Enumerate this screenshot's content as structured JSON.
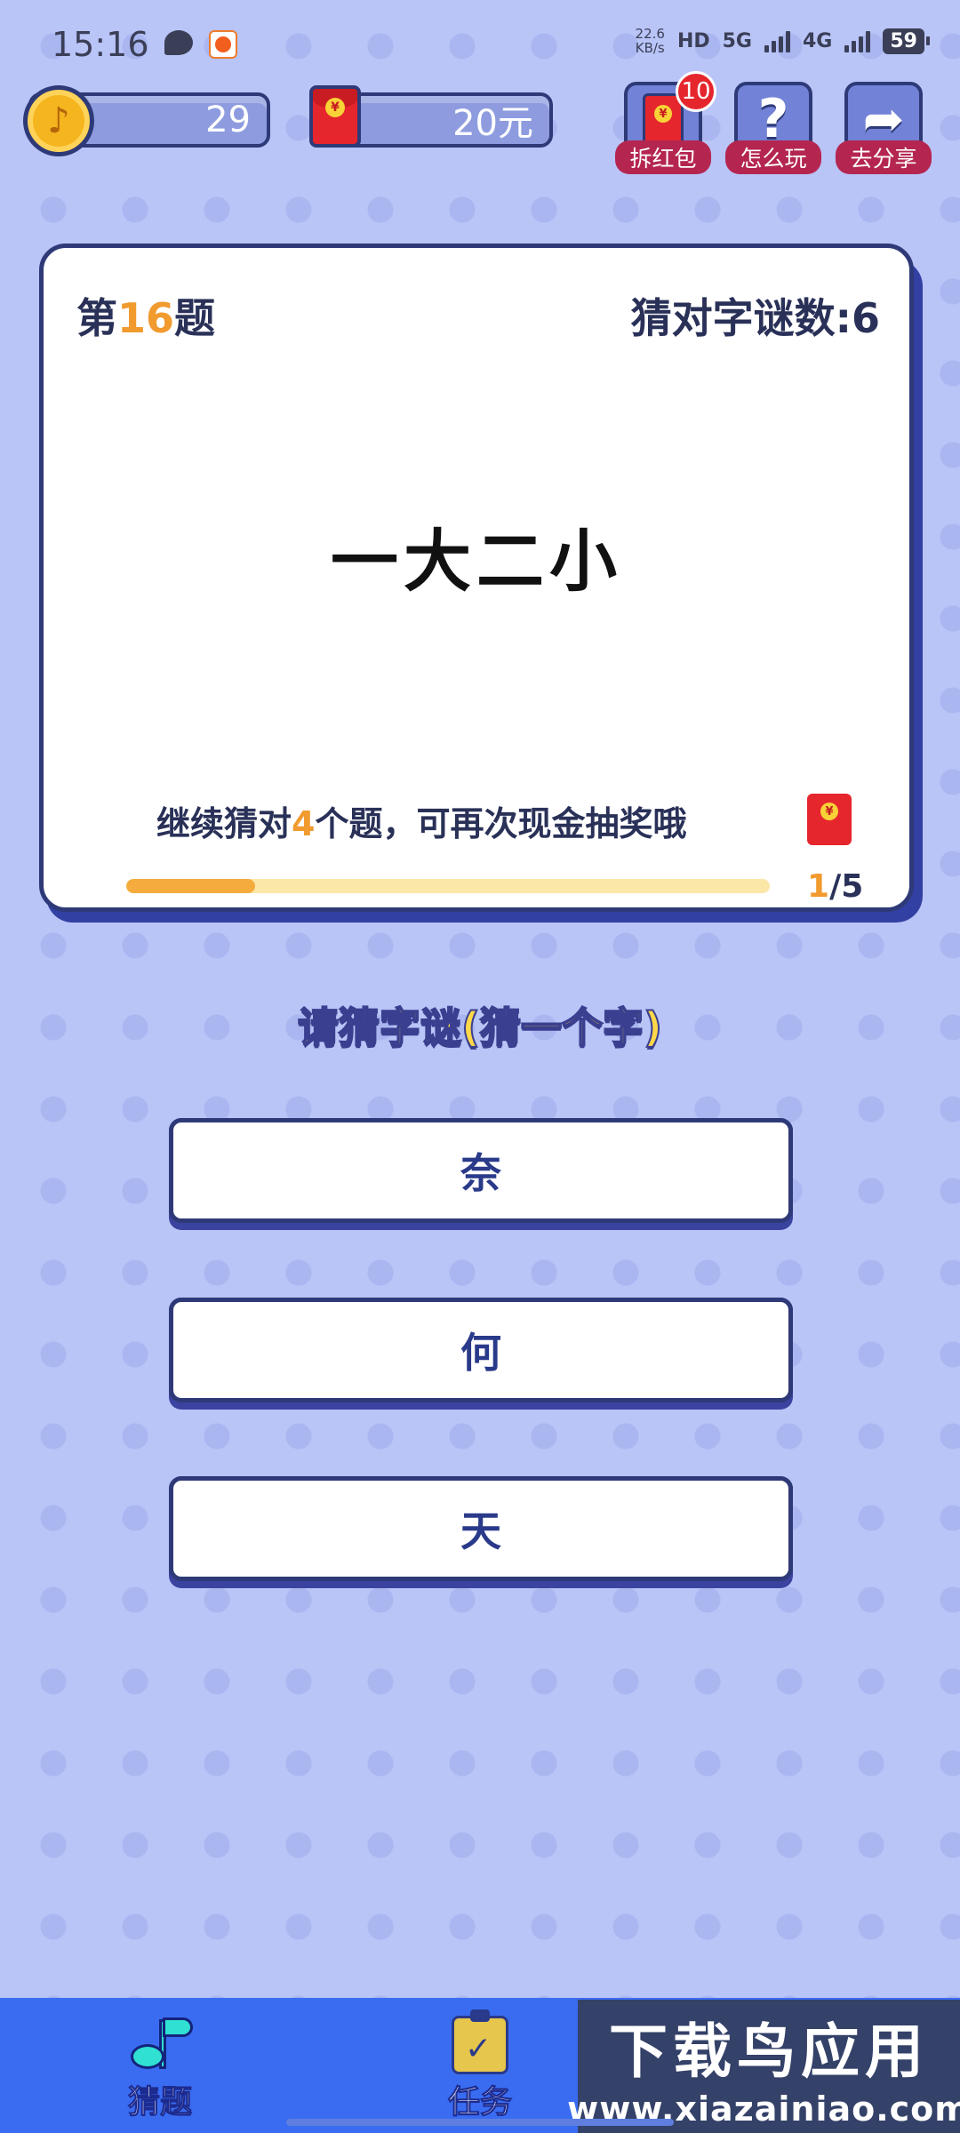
{
  "status_bar": {
    "time": "15:16",
    "speed_value": "22.6",
    "speed_unit": "KB/s",
    "hd_label": "HD",
    "net_5g": "5G",
    "net_4g": "4G",
    "battery": "59"
  },
  "wallet": {
    "coins": "29",
    "cash": "20元"
  },
  "top_buttons": {
    "hongbao_label": "拆红包",
    "hongbao_badge": "10",
    "howto_label": "怎么玩",
    "share_label": "去分享"
  },
  "question_card": {
    "number_prefix": "第",
    "number": "16",
    "number_suffix": "题",
    "solved_label": "猜对字谜数:6",
    "riddle": "一大二小",
    "continue_prefix": "继续猜对",
    "continue_count": "4",
    "continue_suffix": "个题，可再次现金抽奖哦",
    "progress_current": "1",
    "progress_total": "/5",
    "progress_fraction": 0.2
  },
  "prompt": "请猜字谜(猜一个字)",
  "options": [
    "奈",
    "何",
    "天"
  ],
  "bottom_nav": {
    "guess_label": "猜题",
    "task_label": "任务"
  },
  "watermark": {
    "title": "下载鸟应用",
    "url": "www.xiazainiao.com"
  },
  "colors": {
    "background": "#b9c4f7",
    "accent_orange": "#f19a2e",
    "nav_blue": "#3a6cf2",
    "red_packet": "#e5262d",
    "dark_outline": "#2e3a78"
  },
  "icons": [
    "chat-icon",
    "app-icon",
    "coin-icon",
    "red-packet-icon",
    "question-mark-icon",
    "share-arrow-icon",
    "music-note-icon",
    "clipboard-check-icon"
  ]
}
